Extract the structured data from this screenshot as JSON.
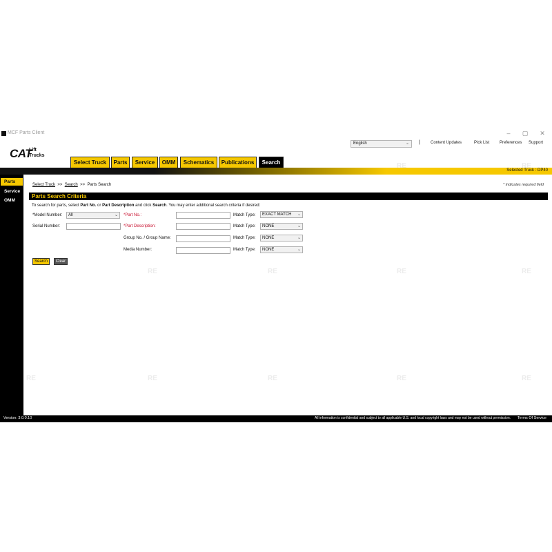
{
  "window": {
    "title": "MCF Parts Client",
    "controls": [
      "–",
      "▢",
      "✕"
    ]
  },
  "logo": {
    "brand": "CAT",
    "sub": "Lift\nTrucks"
  },
  "header": {
    "language": "English",
    "separator": "|",
    "links": [
      "Content Updates",
      "Pick List",
      "Preferences",
      "Support"
    ]
  },
  "tabs": [
    "Select Truck",
    "Parts",
    "Service",
    "OMM",
    "Schematics",
    "Publications",
    "Search"
  ],
  "selected_truck": "Selected Truck : DP40",
  "sidebar": [
    "Parts",
    "Service",
    "OMM"
  ],
  "breadcrumb": {
    "items": [
      "Select Truck",
      "Search",
      "Parts Search"
    ],
    "sep": ">>"
  },
  "required_note": "* Indicates required field",
  "section_title": "Parts Search Criteria",
  "instructions": {
    "t1": "To search for parts, select ",
    "b1": "Part No.",
    "t2": " or ",
    "b2": "Part Description",
    "t3": " and click ",
    "b3": "Search",
    "t4": ". You may enter additional search criteria if desired:"
  },
  "form": {
    "model_label": "*Model Number:",
    "model_value": "All",
    "serial_label": "Serial Number:",
    "part_no_label": "*Part No.:",
    "part_desc_label": "*Part Description:",
    "group_label": "Group No. / Group Name:",
    "media_label": "Media Number:",
    "match_label": "Match Type:",
    "match_values": [
      "EXACT MATCH",
      "NONE",
      "NONE",
      "NONE"
    ],
    "search_label": "Search",
    "clear_label": "Clear"
  },
  "watermark": "RE",
  "footer": {
    "version": "Version: 3.0.0.10",
    "legal": "All information is confidential and subject to all applicable U.S. and local copyright laws and may not be used without permission.",
    "terms": "Terms Of Service"
  },
  "colors": {
    "accent": "#f6c800",
    "dark": "#000000",
    "required": "#c8102e"
  }
}
